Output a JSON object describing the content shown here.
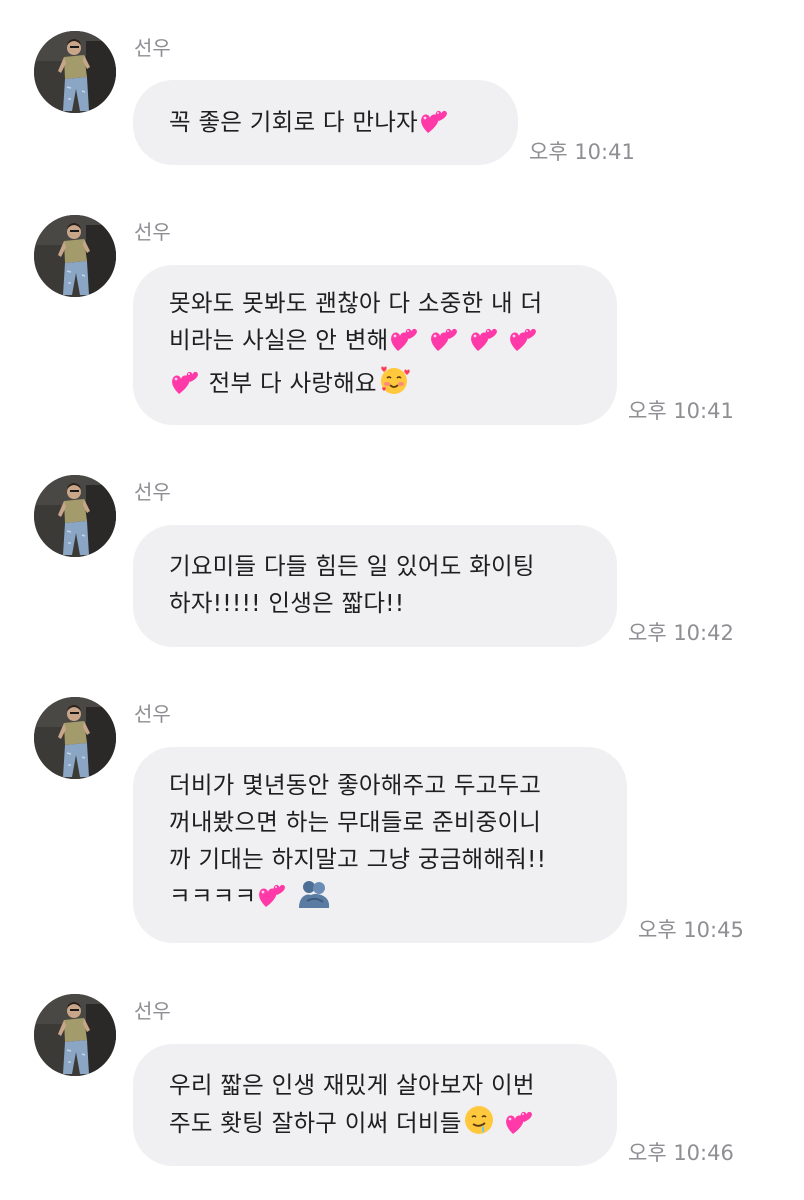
{
  "sender_name": "선우",
  "messages": [
    {
      "lines": [
        "꼭 좋은 기회로 다 만나자💕"
      ],
      "time": "오후 10:41"
    },
    {
      "lines": [
        "못와도 못봐도 괜찮아 다 소중한 내 더",
        "비라는 사실은 안 변해💕 💕 💕 💕",
        "💕 전부 다 사랑해요🥰"
      ],
      "time": "오후 10:41"
    },
    {
      "lines": [
        "기요미들 다들 힘든 일 있어도 화이팅",
        "하자!!!!! 인생은 짧다!!"
      ],
      "time": "오후 10:42"
    },
    {
      "lines": [
        "더비가 몇년동안 좋아해주고 두고두고",
        "꺼내봤으면 하는 무대들로 준비중이니",
        "까 기대는 하지말고 그냥 궁금해해줘!!",
        "ㅋㅋㅋㅋ💕 🫂"
      ],
      "time": "오후 10:45"
    },
    {
      "lines": [
        "우리 짧은 인생 재밌게 살아보자 이번",
        "주도 홧팅 잘하구 이써 더비들🤤 💕"
      ],
      "time": "오후 10:46"
    }
  ],
  "icons": {
    "heart": "two-hearts-icon",
    "smiling_hearts": "smiling-face-with-hearts-icon",
    "hug": "people-hugging-icon",
    "drool": "drooling-face-icon"
  },
  "colors": {
    "bubble_bg": "#f0f0f2",
    "meta_text": "#8e8e93",
    "heart": "#ff3aa8"
  }
}
